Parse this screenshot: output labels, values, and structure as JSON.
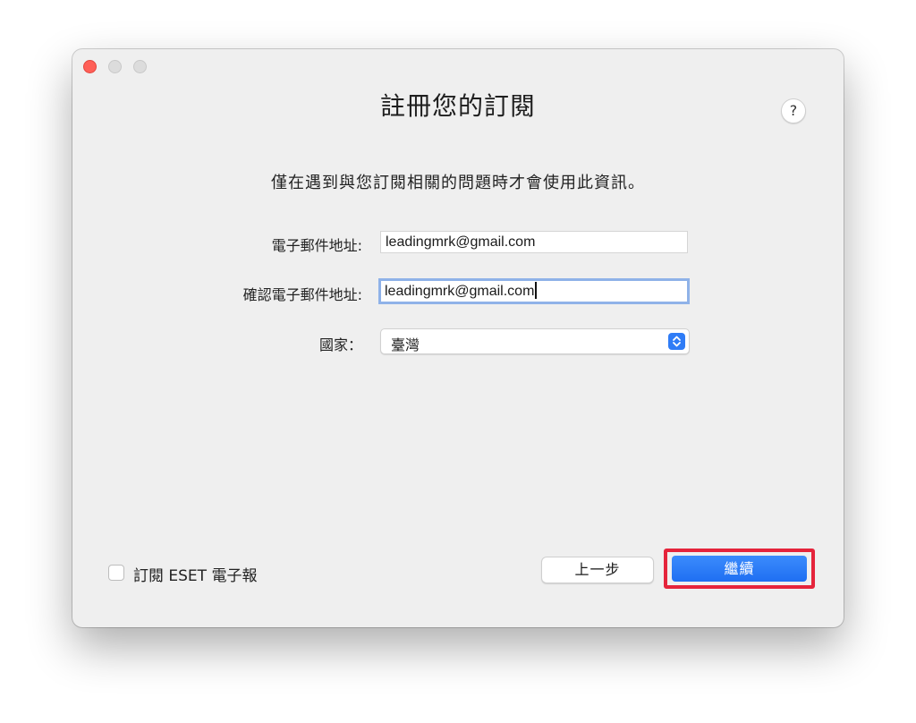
{
  "window": {
    "title": "註冊您的訂閱",
    "subtitle": "僅在遇到與您訂閱相關的問題時才會使用此資訊。",
    "help_label": "?"
  },
  "form": {
    "email_label": "電子郵件地址:",
    "email_value": "leadingmrk@gmail.com",
    "confirm_label": "確認電子郵件地址:",
    "confirm_value": "leadingmrk@gmail.com",
    "country_label": "國家：",
    "country_value": "臺灣"
  },
  "footer": {
    "newsletter_label": "訂閱 ESET 電子報",
    "newsletter_checked": false,
    "back_label": "上一步",
    "continue_label": "繼續"
  },
  "colors": {
    "accent": "#1f6ff2",
    "highlight": "#e5243b",
    "close": "#ff5f57"
  }
}
